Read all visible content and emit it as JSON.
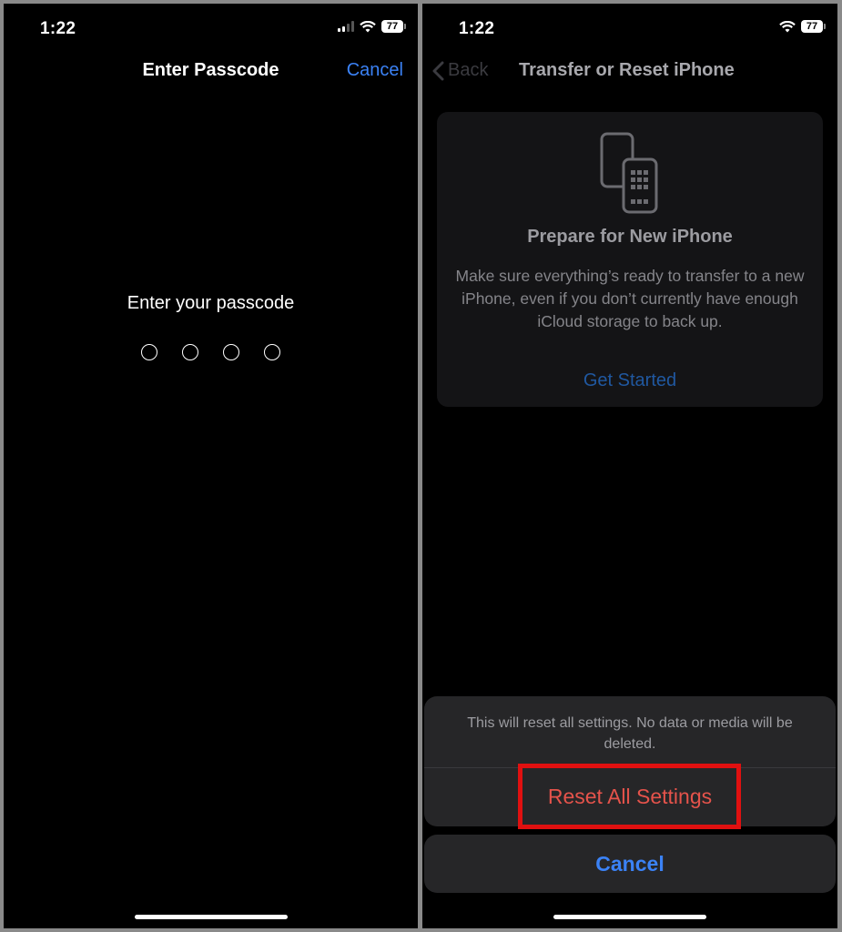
{
  "left": {
    "status_time": "1:22",
    "battery": "77",
    "nav_title": "Enter Passcode",
    "cancel_label": "Cancel",
    "prompt": "Enter your passcode",
    "passcode_dots": 4
  },
  "right": {
    "status_time": "1:22",
    "battery": "77",
    "back_label": "Back",
    "nav_title": "Transfer or Reset iPhone",
    "card": {
      "title": "Prepare for New iPhone",
      "body": "Make sure everything’s ready to transfer to a new iPhone, even if you don’t currently have enough iCloud storage to back up.",
      "link": "Get Started"
    },
    "sheet": {
      "message": "This will reset all settings. No data or media will be deleted.",
      "action_label": "Reset All Settings",
      "cancel_label": "Cancel"
    }
  },
  "colors": {
    "accent_blue": "#3b82f6",
    "destructive_red": "#e5534b",
    "highlight_red": "#e01010"
  }
}
